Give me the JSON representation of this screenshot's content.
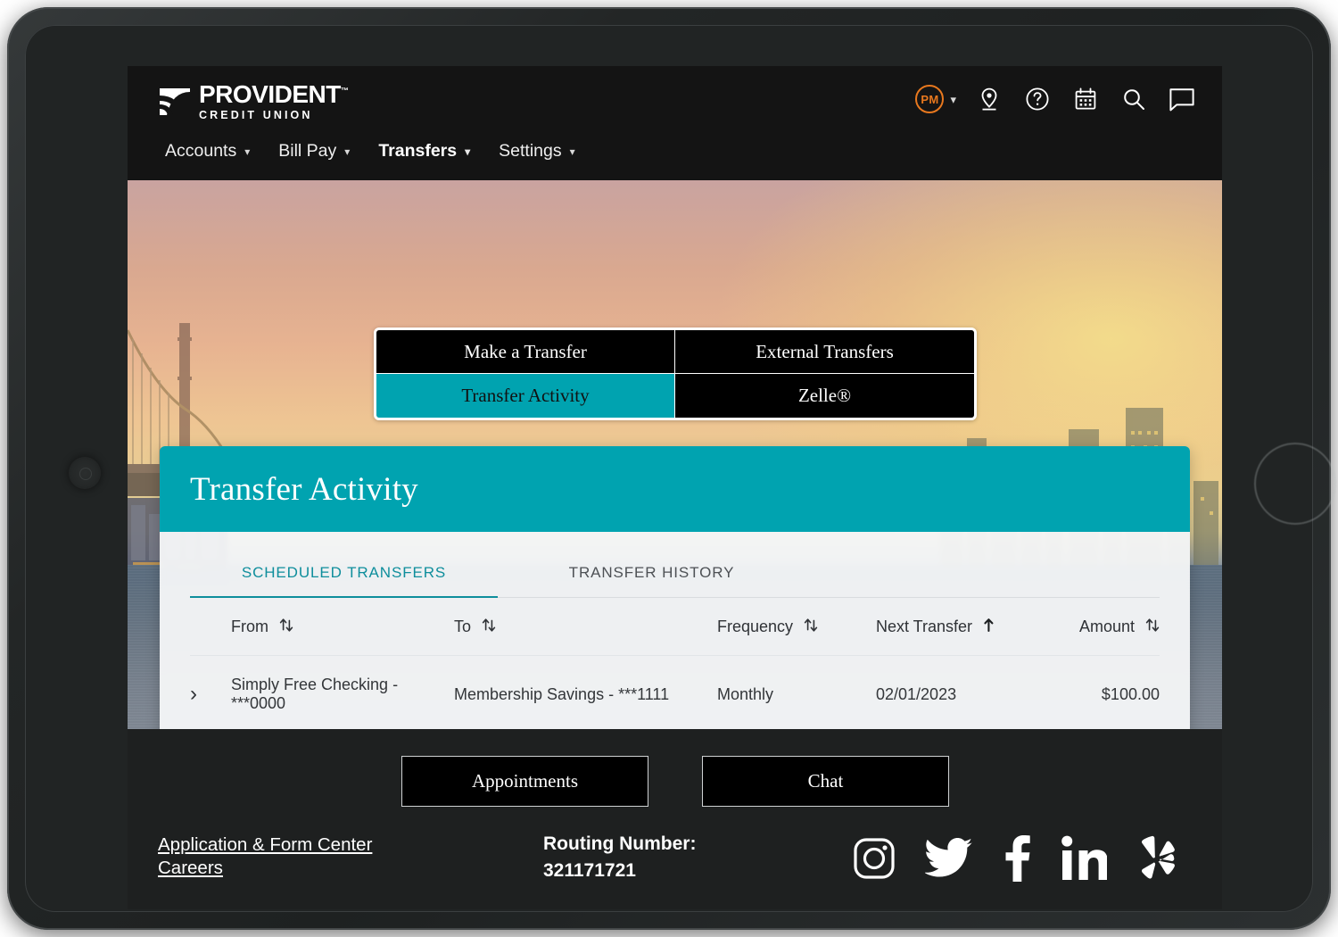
{
  "brand": {
    "name_line1": "PROVIDENT",
    "name_line2": "CREDIT UNION",
    "tm": "™",
    "accent_orange": "#e8781e",
    "accent_teal": "#00a3b0"
  },
  "header": {
    "avatar_initials": "PM",
    "icons": [
      {
        "name": "location-pin-icon",
        "glyph": "pin"
      },
      {
        "name": "help-icon",
        "glyph": "question"
      },
      {
        "name": "calendar-icon",
        "glyph": "calendar"
      },
      {
        "name": "search-icon",
        "glyph": "search"
      },
      {
        "name": "chat-icon",
        "glyph": "chat"
      }
    ]
  },
  "nav": {
    "items": [
      {
        "label": "Accounts",
        "active": false
      },
      {
        "label": "Bill Pay",
        "active": false
      },
      {
        "label": "Transfers",
        "active": true
      },
      {
        "label": "Settings",
        "active": false
      }
    ]
  },
  "segment": {
    "buttons": [
      {
        "label": "Make a Transfer",
        "active": false
      },
      {
        "label": "External Transfers",
        "active": false
      },
      {
        "label": "Transfer Activity",
        "active": true
      },
      {
        "label": "Zelle®",
        "active": false
      }
    ]
  },
  "card": {
    "title": "Transfer Activity",
    "tabs": [
      {
        "label": "SCHEDULED TRANSFERS",
        "active": true
      },
      {
        "label": "TRANSFER HISTORY",
        "active": false
      }
    ],
    "table": {
      "columns": [
        {
          "label": "From",
          "sort": "both"
        },
        {
          "label": "To",
          "sort": "both"
        },
        {
          "label": "Frequency",
          "sort": "both"
        },
        {
          "label": "Next Transfer",
          "sort": "asc"
        },
        {
          "label": "Amount",
          "sort": "both"
        }
      ],
      "rows": [
        {
          "from": "Simply Free Checking - ***0000",
          "to": "Membership Savings - ***1111",
          "frequency": "Monthly",
          "next_transfer": "02/01/2023",
          "amount": "$100.00"
        }
      ]
    }
  },
  "footer": {
    "buttons": [
      {
        "label": "Appointments"
      },
      {
        "label": "Chat"
      }
    ],
    "links": [
      {
        "label": "Application & Form Center"
      },
      {
        "label": "Careers"
      }
    ],
    "routing_label": "Routing Number:",
    "routing_value": "321171721",
    "social": [
      {
        "name": "instagram-icon"
      },
      {
        "name": "twitter-icon"
      },
      {
        "name": "facebook-icon"
      },
      {
        "name": "linkedin-icon"
      },
      {
        "name": "yelp-icon"
      }
    ]
  }
}
